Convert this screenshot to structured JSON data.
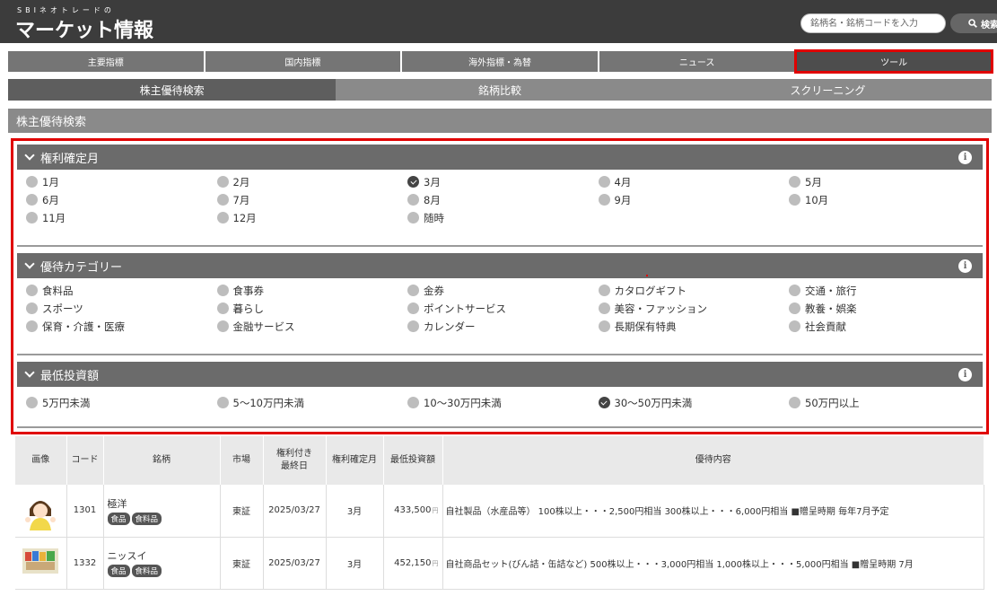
{
  "header": {
    "logo_top": "SBIネオトレードの",
    "logo_main": "マーケット情報",
    "search_placeholder": "銘柄名・銘柄コードを入力",
    "search_button": "検索"
  },
  "main_nav": [
    {
      "label": "主要指標",
      "active": false
    },
    {
      "label": "国内指標",
      "active": false
    },
    {
      "label": "海外指標・為替",
      "active": false
    },
    {
      "label": "ニュース",
      "active": false
    },
    {
      "label": "ツール",
      "active": true
    }
  ],
  "sub_nav": [
    {
      "label": "株主優待検索",
      "active": true
    },
    {
      "label": "銘柄比較",
      "active": false
    },
    {
      "label": "スクリーニング",
      "active": false
    }
  ],
  "section_title": "株主優待検索",
  "filters": {
    "month": {
      "title": "権利確定月",
      "options": [
        {
          "label": "1月",
          "checked": false
        },
        {
          "label": "2月",
          "checked": false
        },
        {
          "label": "3月",
          "checked": true
        },
        {
          "label": "4月",
          "checked": false
        },
        {
          "label": "5月",
          "checked": false
        },
        {
          "label": "6月",
          "checked": false
        },
        {
          "label": "7月",
          "checked": false
        },
        {
          "label": "8月",
          "checked": false
        },
        {
          "label": "9月",
          "checked": false
        },
        {
          "label": "10月",
          "checked": false
        },
        {
          "label": "11月",
          "checked": false
        },
        {
          "label": "12月",
          "checked": false
        },
        {
          "label": "随時",
          "checked": false
        }
      ]
    },
    "category": {
      "title": "優待カテゴリー",
      "options": [
        {
          "label": "食料品",
          "checked": false
        },
        {
          "label": "食事券",
          "checked": false
        },
        {
          "label": "金券",
          "checked": false
        },
        {
          "label": "カタログギフト",
          "checked": false
        },
        {
          "label": "交通・旅行",
          "checked": false
        },
        {
          "label": "スポーツ",
          "checked": false
        },
        {
          "label": "暮らし",
          "checked": false
        },
        {
          "label": "ポイントサービス",
          "checked": false
        },
        {
          "label": "美容・ファッション",
          "checked": false
        },
        {
          "label": "教養・娯楽",
          "checked": false
        },
        {
          "label": "保育・介護・医療",
          "checked": false
        },
        {
          "label": "金融サービス",
          "checked": false
        },
        {
          "label": "カレンダー",
          "checked": false
        },
        {
          "label": "長期保有特典",
          "checked": false
        },
        {
          "label": "社会貢献",
          "checked": false
        }
      ]
    },
    "investment": {
      "title": "最低投資額",
      "options": [
        {
          "label": "5万円未満",
          "checked": false
        },
        {
          "label": "5～10万円未満",
          "checked": false
        },
        {
          "label": "10～30万円未満",
          "checked": false
        },
        {
          "label": "30～50万円未満",
          "checked": true
        },
        {
          "label": "50万円以上",
          "checked": false
        }
      ]
    }
  },
  "table": {
    "headers": [
      "画像",
      "コード",
      "銘柄",
      "市場",
      "権利付き\n最終日",
      "権利確定月",
      "最低投資額",
      "優待内容"
    ],
    "rows": [
      {
        "code": "1301",
        "name": "極洋",
        "tags": [
          "食品",
          "食料品"
        ],
        "market": "東証",
        "last_day": "2025/03/27",
        "month": "3月",
        "min_invest": "433,500",
        "yen": "円",
        "benefit": "自社製品（水産品等） 100株以上・・・2,500円相当 300株以上・・・6,000円相当 ■贈呈時期 毎年7月予定"
      },
      {
        "code": "1332",
        "name": "ニッスイ",
        "tags": [
          "食品",
          "食料品"
        ],
        "market": "東証",
        "last_day": "2025/03/27",
        "month": "3月",
        "min_invest": "452,150",
        "yen": "円",
        "benefit": "自社商品セット(びん詰・缶詰など) 500株以上・・・3,000円相当 1,000株以上・・・5,000円相当 ■贈呈時期 7月"
      }
    ]
  },
  "colors": {
    "header_bg": "#3c3c3c",
    "highlight_red": "#e00000",
    "nav_gray": "#757575"
  }
}
